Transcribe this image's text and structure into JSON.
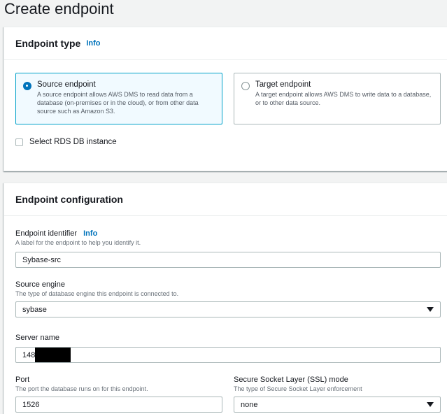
{
  "page": {
    "title": "Create endpoint"
  },
  "endpoint_type": {
    "heading": "Endpoint type",
    "info": "Info",
    "options": [
      {
        "title": "Source endpoint",
        "description": "A source endpoint allows AWS DMS to read data from a database (on-premises or in the cloud), or from other data source such as Amazon S3.",
        "selected": true
      },
      {
        "title": "Target endpoint",
        "description": "A target endpoint allows AWS DMS to write data to a database, or to other data source.",
        "selected": false
      }
    ],
    "rds_checkbox_label": "Select RDS DB instance"
  },
  "endpoint_config": {
    "heading": "Endpoint configuration",
    "identifier": {
      "label": "Endpoint identifier",
      "info": "Info",
      "description": "A label for the endpoint to help you identify it.",
      "value": "Sybase-src"
    },
    "source_engine": {
      "label": "Source engine",
      "description": "The type of database engine this endpoint is connected to.",
      "value": "sybase"
    },
    "server_name": {
      "label": "Server name",
      "value": "148"
    },
    "port": {
      "label": "Port",
      "description": "The port the database runs on for this endpoint.",
      "value": "1526"
    },
    "ssl_mode": {
      "label": "Secure Socket Layer (SSL) mode",
      "description": "The type of Secure Socket Layer enforcement",
      "value": "none"
    }
  },
  "colors": {
    "link": "#0073bb",
    "selected_border": "#00a1c9",
    "selected_bg": "#f1faff"
  }
}
